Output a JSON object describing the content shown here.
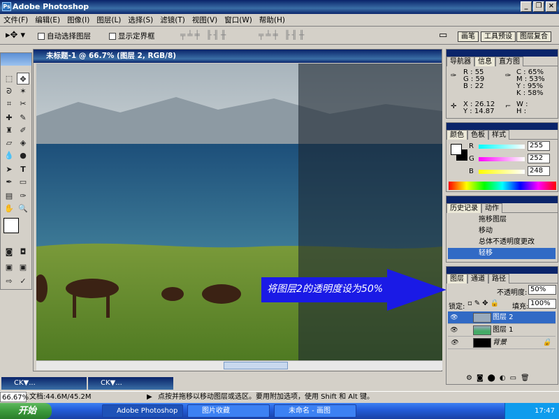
{
  "app": {
    "title": "Adobe Photoshop"
  },
  "menu": [
    "文件(F)",
    "编辑(E)",
    "图像(I)",
    "图层(L)",
    "选择(S)",
    "滤镜(T)",
    "视图(V)",
    "窗口(W)",
    "帮助(H)"
  ],
  "options": {
    "auto_select": "自动选择图层",
    "show_bounds": "显示定界框"
  },
  "palette_tabs": [
    "画笔",
    "工具预设",
    "图层复合"
  ],
  "document": {
    "title": "未标题-1 @ 66.7% (图层 2, RGB/8)"
  },
  "annotation": "将图层2的透明度设为50%",
  "info_panel": {
    "tabs": [
      "导航器",
      "信息",
      "直方图"
    ],
    "r_label": "R :",
    "r": "55",
    "g_label": "G :",
    "g": "59",
    "b_label": "B :",
    "b": "22",
    "c_label": "C :",
    "c": "65%",
    "m_label": "M :",
    "m": "53%",
    "y_label": "Y :",
    "y": "95%",
    "k_label": "K :",
    "k": "58%",
    "x_label": "X :",
    "x": "26.12",
    "yy_label": "Y :",
    "yy": "14.87",
    "w_label": "W :",
    "h_label": "H :"
  },
  "color_panel": {
    "tabs": [
      "颜色",
      "色板",
      "样式"
    ],
    "r_label": "R",
    "r": "255",
    "g_label": "G",
    "g": "252",
    "b_label": "B",
    "b": "248"
  },
  "history_panel": {
    "tabs": [
      "历史记录",
      "动作"
    ],
    "items": [
      "拖移图层",
      "移动",
      "总体不透明度更改",
      "轻移"
    ]
  },
  "layers_panel": {
    "tabs": [
      "图层",
      "通道",
      "路径"
    ],
    "opacity_label": "不透明度:",
    "opacity": "50%",
    "lock_label": "锁定:",
    "fill_label": "填充:",
    "fill": "100%",
    "layers": [
      "图层 2",
      "图层 1",
      "背景"
    ]
  },
  "minimized": [
    "CK▼...",
    "CK▼..."
  ],
  "status": {
    "zoom": "66.67%",
    "doc": "文档:44.6M/45.2M",
    "hint": "点按并拖移以移动图层或选区。要用附加选项，使用 Shift 和 Alt 键。"
  },
  "taskbar": {
    "start": "开始",
    "items": [
      "Adobe Photoshop",
      "图片收藏",
      "未命名 - 画图"
    ],
    "clock": "17:47"
  }
}
